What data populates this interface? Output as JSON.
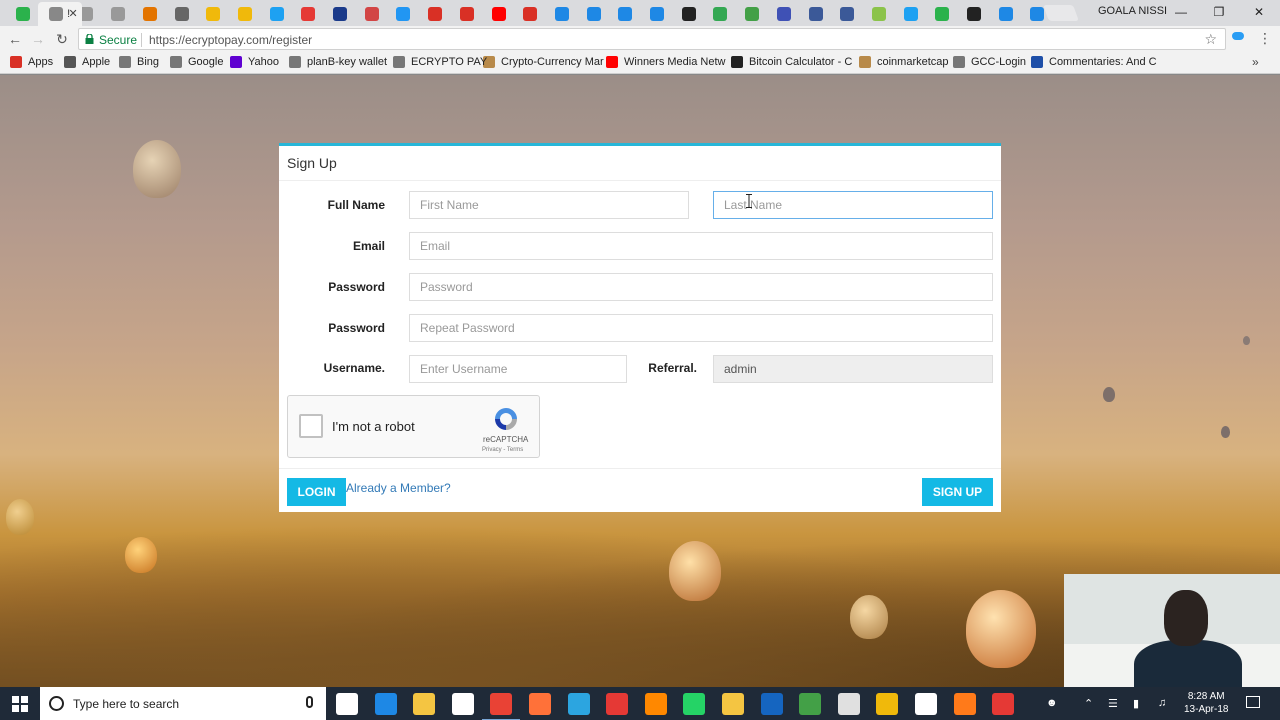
{
  "browser": {
    "tabs": [
      {
        "icon": "green-circle-icon",
        "color": "#2bb24c"
      },
      {
        "icon": "page-icon",
        "color": "#888888",
        "active": true,
        "title": "!"
      },
      {
        "icon": "doc-icon",
        "color": "#999999"
      },
      {
        "icon": "doc-icon",
        "color": "#999999"
      },
      {
        "icon": "hammer-icon",
        "color": "#e37400"
      },
      {
        "icon": "nodes-icon",
        "color": "#666666"
      },
      {
        "icon": "diamond-icon",
        "color": "#f0b90b"
      },
      {
        "icon": "diamond-icon",
        "color": "#f0b90b"
      },
      {
        "icon": "bird-icon",
        "color": "#1da1f2"
      },
      {
        "icon": "rings-icon",
        "color": "#e53935"
      },
      {
        "icon": "ce-icon",
        "color": "#1a3a8a"
      },
      {
        "icon": "shield-icon",
        "color": "#d24545"
      },
      {
        "icon": "cloud-icon",
        "color": "#2196f3"
      },
      {
        "icon": "gmail-icon",
        "color": "#d93025"
      },
      {
        "icon": "gmail-icon",
        "color": "#d93025"
      },
      {
        "icon": "youtube-icon",
        "color": "#ff0000"
      },
      {
        "icon": "gmail-icon",
        "color": "#d93025"
      },
      {
        "icon": "square-icon",
        "color": "#1e88e5"
      },
      {
        "icon": "square-icon",
        "color": "#1e88e5"
      },
      {
        "icon": "square-icon",
        "color": "#1e88e5"
      },
      {
        "icon": "square-icon",
        "color": "#1e88e5"
      },
      {
        "icon": "coin-icon",
        "color": "#222222"
      },
      {
        "icon": "g-icon",
        "color": "#34a853"
      },
      {
        "icon": "calc-icon",
        "color": "#43a047"
      },
      {
        "icon": "book-icon",
        "color": "#3f51b5"
      },
      {
        "icon": "facebook-icon",
        "color": "#3b5998"
      },
      {
        "icon": "facebook-icon",
        "color": "#3b5998"
      },
      {
        "icon": "arrow-icon",
        "color": "#8bc34a"
      },
      {
        "icon": "twitter-icon",
        "color": "#1da1f2"
      },
      {
        "icon": "bitcoin-icon",
        "color": "#2bb24c"
      },
      {
        "icon": "grid-icon",
        "color": "#222222"
      },
      {
        "icon": "yo-icon",
        "color": "#1e88e5"
      },
      {
        "icon": "chat-icon",
        "color": "#1e88e5"
      }
    ],
    "profile_name": "GOALA NISSI",
    "secure_label": "Secure",
    "url": "https://ecryptopay.com/register",
    "bookmarks": [
      {
        "label": "Apps",
        "icon": "apps-grid-icon",
        "color": "#d93025"
      },
      {
        "label": "Apple",
        "icon": "apple-icon",
        "color": "#555555"
      },
      {
        "label": "Bing",
        "icon": "page-icon",
        "color": "#777777"
      },
      {
        "label": "Google",
        "icon": "page-icon",
        "color": "#777777"
      },
      {
        "label": "Yahoo",
        "icon": "yahoo-icon",
        "color": "#5f01d1"
      },
      {
        "label": "planB-key wallet",
        "icon": "page-icon",
        "color": "#777777"
      },
      {
        "label": "ECRYPTO PAY",
        "icon": "page-icon",
        "color": "#777777"
      },
      {
        "label": "Crypto-Currency Mar",
        "icon": "coin-icon",
        "color": "#b88a4a"
      },
      {
        "label": "Winners Media Netw",
        "icon": "youtube-icon",
        "color": "#ff0000"
      },
      {
        "label": "Bitcoin Calculator - C",
        "icon": "grid-icon",
        "color": "#222222"
      },
      {
        "label": "coinmarketcap",
        "icon": "coin-icon",
        "color": "#b88a4a"
      },
      {
        "label": "GCC-Login",
        "icon": "page-icon",
        "color": "#777777"
      },
      {
        "label": "Commentaries: And C",
        "icon": "cross-icon",
        "color": "#1e4fa8"
      }
    ]
  },
  "form": {
    "title": "Sign Up",
    "full_name_label": "Full Name",
    "first_name_placeholder": "First Name",
    "last_name_placeholder": "Last Name",
    "email_label": "Email",
    "email_placeholder": "Email",
    "password_label": "Password",
    "password_placeholder": "Password",
    "repeat_password_label": "Password",
    "repeat_password_placeholder": "Repeat Password",
    "username_label": "Username.",
    "username_placeholder": "Enter Username",
    "referral_label": "Referral.",
    "referral_value": "admin",
    "captcha_text": "I'm not a robot",
    "captcha_brand": "reCAPTCHA",
    "captcha_links": "Privacy - Terms",
    "login_button": "LOGIN",
    "member_link": "Already a Member?",
    "signup_button": "SIGN UP",
    "accent_color": "#14b9e5"
  },
  "taskbar": {
    "search_placeholder": "Type here to search",
    "apps": [
      {
        "icon": "task-view-icon",
        "color": "#ffffff"
      },
      {
        "icon": "edge-icon",
        "color": "#1e88e5"
      },
      {
        "icon": "folder-icon",
        "color": "#f4c542"
      },
      {
        "icon": "store-icon",
        "color": "#ffffff"
      },
      {
        "icon": "chrome-icon",
        "color": "#e94235",
        "active": true
      },
      {
        "icon": "firefox-icon",
        "color": "#ff7139"
      },
      {
        "icon": "telegram-icon",
        "color": "#2ca5e0"
      },
      {
        "icon": "pdf-icon",
        "color": "#e53935"
      },
      {
        "icon": "vlc-icon",
        "color": "#ff8800"
      },
      {
        "icon": "whatsapp-icon",
        "color": "#25d366"
      },
      {
        "icon": "lock-icon",
        "color": "#f4c542"
      },
      {
        "icon": "b-icon",
        "color": "#1565c0"
      },
      {
        "icon": "leaf-icon",
        "color": "#43a047"
      },
      {
        "icon": "music-icon",
        "color": "#e0e0e0"
      },
      {
        "icon": "binance-icon",
        "color": "#f0b90b"
      },
      {
        "icon": "note-icon",
        "color": "#ffffff"
      },
      {
        "icon": "orange-app-icon",
        "color": "#ff7a1a"
      },
      {
        "icon": "pulse-icon",
        "color": "#e53935"
      }
    ],
    "time": "8:28 AM",
    "date": "13-Apr-18"
  }
}
